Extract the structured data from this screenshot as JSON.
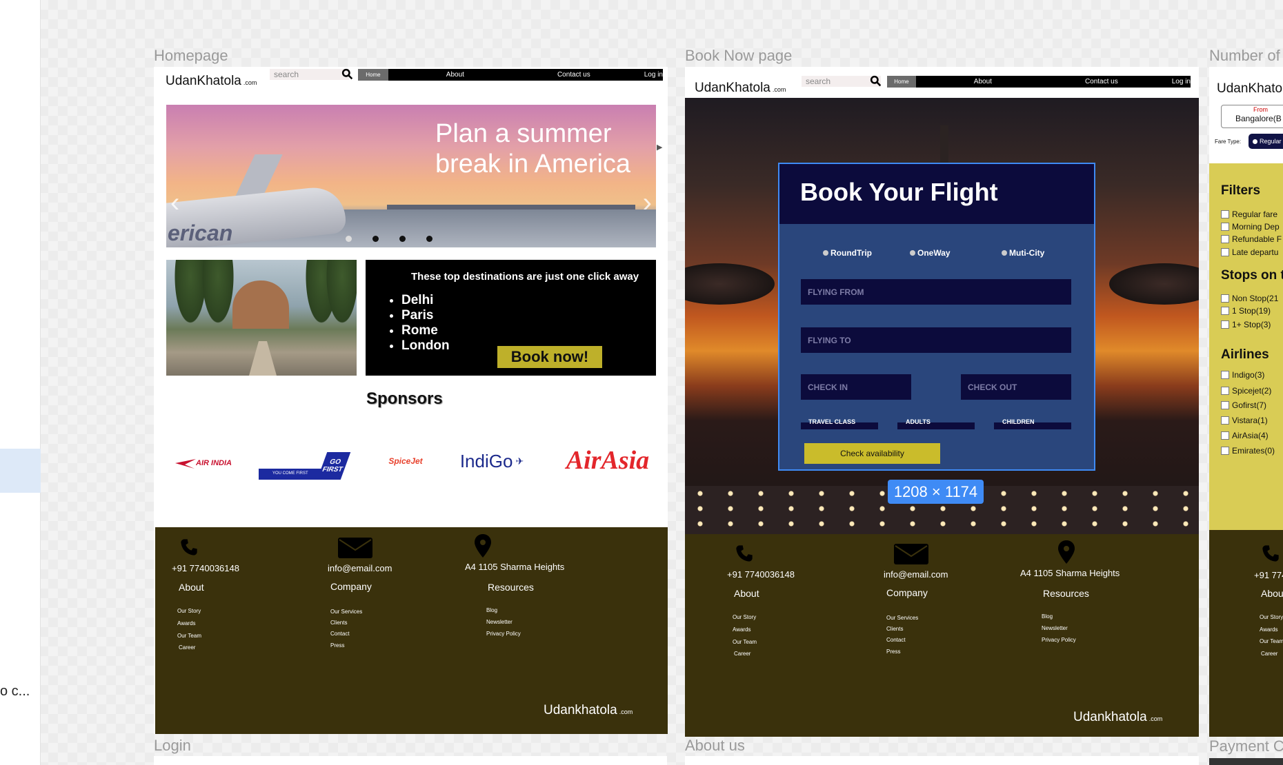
{
  "frames": {
    "homepage": "Homepage",
    "book": "Book Now page",
    "third": "Number of",
    "login": "Login",
    "about": "About us",
    "payment": "Payment C"
  },
  "sidebar": {
    "truncated": "o c..."
  },
  "nav": {
    "logo": "UdanKhatola",
    "logo_suffix": ".com",
    "search_placeholder": "search",
    "home": "Home",
    "about": "About",
    "contact": "Contact us",
    "login": "Log in"
  },
  "home": {
    "hero_title": "Plan a summer break in America",
    "hero_brand": "erican",
    "dest_heading": "These top destinations are just one click away",
    "destinations": [
      "Delhi",
      "Paris",
      "Rome",
      "London"
    ],
    "book_now": "Book now!",
    "sponsors": "Sponsors",
    "sponsor_logos": [
      "AIR INDIA",
      "GO FIRST",
      "SpiceJet",
      "IndiGo",
      "AirAsia"
    ],
    "gofirst_tag": "YOU COME FIRST"
  },
  "footer": {
    "phone": "+91 7740036148",
    "email": "info@email.com",
    "address": "A4 1105 Sharma Heights",
    "about_h": "About",
    "about_items": [
      "Our Story",
      "Awards",
      "Our Team",
      "Career"
    ],
    "company_h": "Company",
    "company_items": [
      "Our Services",
      "Clients",
      "Contact",
      "Press"
    ],
    "resources_h": "Resources",
    "resources_items": [
      "Blog",
      "Newsletter",
      "Privacy Policy"
    ],
    "brand": "Udankhatola",
    "brand_suffix": ".com"
  },
  "book": {
    "title": "Book Your Flight",
    "trip_types": [
      "RoundTrip",
      "OneWay",
      "Muti-City"
    ],
    "flying_from": "FLYING FROM",
    "flying_to": "FLYING TO",
    "check_in": "CHECK IN",
    "check_out": "CHECK OUT",
    "travel_class": "TRAVEL CLASS",
    "adults": "ADULTS",
    "children": "CHILDREN",
    "check_availability": "Check availability",
    "dimension_badge": "1208 × 1174"
  },
  "third": {
    "logo": "UdanKhato",
    "from_label": "From",
    "from_value": "Bangalore(B",
    "fare_type": "Fare Type:",
    "fare_option": "Regular",
    "filters_h": "Filters",
    "filters": [
      "Regular fare",
      "Morning Dep",
      "Refundable F",
      "Late departu"
    ],
    "stops_h": "Stops on t",
    "stops": [
      "Non Stop(21",
      "1 Stop(19)",
      "1+ Stop(3)"
    ],
    "airlines_h": "Airlines",
    "airlines": [
      "Indigo(3)",
      "Spicejet(2)",
      "Gofirst(7)",
      "Vistara(1)",
      "AirAsia(4)",
      "Emirates(0)"
    ],
    "footer_phone": "+91 774",
    "footer_about": "Abou",
    "footer_items": [
      "Our Story",
      "Awards",
      "Our Team",
      "Career"
    ]
  }
}
